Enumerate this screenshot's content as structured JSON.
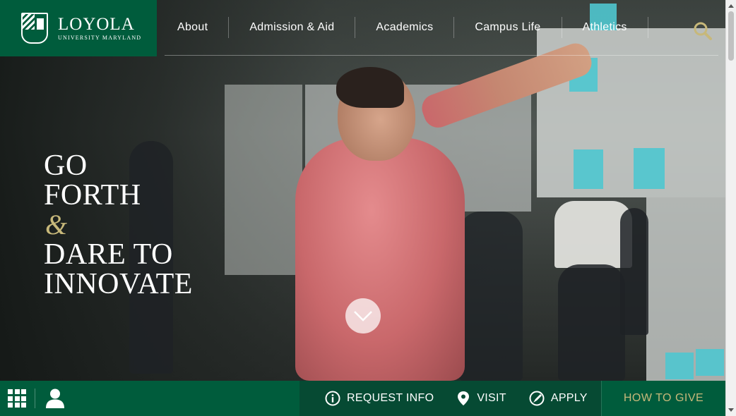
{
  "logo": {
    "name": "LOYOLA",
    "subtitle": "UNIVERSITY MARYLAND"
  },
  "nav": {
    "items": [
      {
        "label": "About"
      },
      {
        "label": "Admission & Aid"
      },
      {
        "label": "Academics"
      },
      {
        "label": "Campus Life"
      },
      {
        "label": "Athletics"
      }
    ],
    "search_icon": "magnifier-icon"
  },
  "hero": {
    "line1": "GO",
    "line2": "FORTH",
    "amp": "&",
    "line3": "DARE TO",
    "line4": "INNOVATE",
    "scroll_icon": "chevron-down-icon"
  },
  "bottom": {
    "request_info": "REQUEST INFO",
    "visit": "VISIT",
    "apply": "APPLY",
    "give": "HOW TO GIVE"
  },
  "colors": {
    "brand_green": "#005c3c",
    "dark_green": "#064a33",
    "gold": "#c7b87a"
  }
}
